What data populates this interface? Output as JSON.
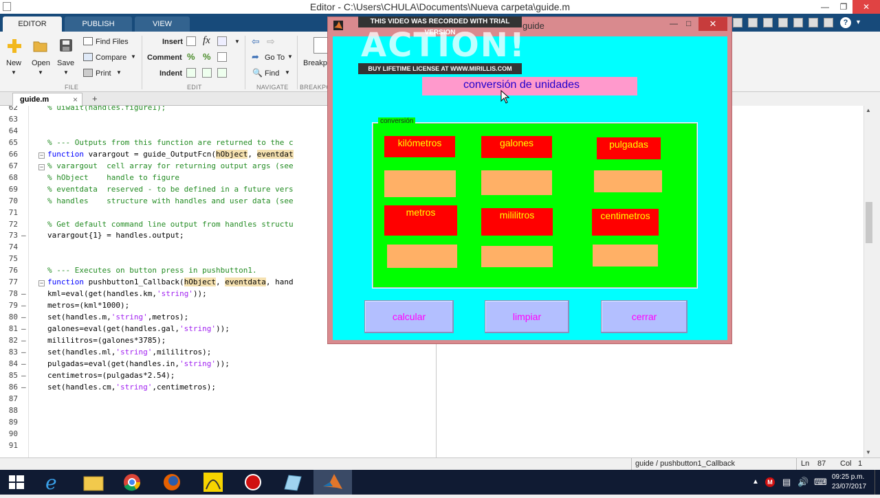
{
  "window": {
    "title": "Editor - C:\\Users\\CHULA\\Documents\\Nueva carpeta\\guide.m"
  },
  "ribbon": {
    "tabs": [
      "EDITOR",
      "PUBLISH",
      "VIEW"
    ],
    "file": {
      "new": "New",
      "open": "Open",
      "save": "Save",
      "find_files": "Find Files",
      "compare": "Compare",
      "print": "Print",
      "section": "FILE"
    },
    "edit": {
      "insert": "Insert",
      "comment": "Comment",
      "indent": "Indent",
      "section": "EDIT"
    },
    "navigate": {
      "goto": "Go To",
      "find": "Find",
      "section": "NAVIGATE"
    },
    "breakpoints": {
      "label": "Breakpo",
      "section": "BREAKPO"
    }
  },
  "editor": {
    "file_tab": "guide.m",
    "lines": [
      {
        "n": "62",
        "segments": [
          [
            "c",
            "% uiwait(handles.figure1);"
          ]
        ]
      },
      {
        "n": "63",
        "segments": []
      },
      {
        "n": "64",
        "segments": []
      },
      {
        "n": "65",
        "segments": [
          [
            "c",
            "% --- Outputs from this function are returned to the c"
          ]
        ]
      },
      {
        "n": "66",
        "fold": true,
        "segments": [
          [
            "k",
            "function"
          ],
          [
            "t",
            " varargout = guide_OutputFcn("
          ],
          [
            "h",
            "hObject"
          ],
          [
            "t",
            ", "
          ],
          [
            "h",
            "eventdat"
          ]
        ]
      },
      {
        "n": "67",
        "fold": true,
        "segments": [
          [
            "c",
            "% varargout  cell array for returning output args (see"
          ]
        ]
      },
      {
        "n": "68",
        "segments": [
          [
            "c",
            "% hObject    handle to figure"
          ]
        ]
      },
      {
        "n": "69",
        "segments": [
          [
            "c",
            "% eventdata  reserved - to be defined in a future vers"
          ]
        ]
      },
      {
        "n": "70",
        "segments": [
          [
            "c",
            "% handles    structure with handles and user data (see"
          ]
        ]
      },
      {
        "n": "71",
        "segments": []
      },
      {
        "n": "72",
        "segments": [
          [
            "c",
            "% Get default command line output from handles structu"
          ]
        ]
      },
      {
        "n": "73",
        "dash": true,
        "segments": [
          [
            "t",
            "varargout{1} = handles.output;"
          ]
        ]
      },
      {
        "n": "74",
        "segments": []
      },
      {
        "n": "75",
        "segments": []
      },
      {
        "n": "76",
        "segments": [
          [
            "c",
            "% --- Executes on button press in pushbutton1."
          ]
        ]
      },
      {
        "n": "77",
        "fold": true,
        "segments": [
          [
            "k",
            "function"
          ],
          [
            "t",
            " pushbutton1_Callback("
          ],
          [
            "h",
            "hObject"
          ],
          [
            "t",
            ", "
          ],
          [
            "h",
            "eventdata"
          ],
          [
            "t",
            ", hand"
          ]
        ]
      },
      {
        "n": "78",
        "dash": true,
        "segments": [
          [
            "t",
            "kml=eval(get(handles.km,"
          ],
          [
            "s",
            "'string'"
          ],
          [
            "t",
            "));"
          ]
        ]
      },
      {
        "n": "79",
        "dash": true,
        "segments": [
          [
            "t",
            "metros=(kml*1000);"
          ]
        ]
      },
      {
        "n": "80",
        "dash": true,
        "segments": [
          [
            "t",
            "set(handles.m,"
          ],
          [
            "s",
            "'string'"
          ],
          [
            "t",
            ",metros);"
          ]
        ]
      },
      {
        "n": "81",
        "dash": true,
        "segments": [
          [
            "t",
            "galones=eval(get(handles.gal,"
          ],
          [
            "s",
            "'string'"
          ],
          [
            "t",
            "));"
          ]
        ]
      },
      {
        "n": "82",
        "dash": true,
        "segments": [
          [
            "t",
            "mililitros=(galones*3785);"
          ]
        ]
      },
      {
        "n": "83",
        "dash": true,
        "segments": [
          [
            "t",
            "set(handles.ml,"
          ],
          [
            "s",
            "'string'"
          ],
          [
            "t",
            ",mililitros);"
          ]
        ]
      },
      {
        "n": "84",
        "dash": true,
        "segments": [
          [
            "t",
            "pulgadas=eval(get(handles.in,"
          ],
          [
            "s",
            "'string'"
          ],
          [
            "t",
            "));"
          ]
        ]
      },
      {
        "n": "85",
        "dash": true,
        "segments": [
          [
            "t",
            "centimetros=(pulgadas*2.54);"
          ]
        ]
      },
      {
        "n": "86",
        "dash": true,
        "segments": [
          [
            "t",
            "set(handles.cm,"
          ],
          [
            "s",
            "'string'"
          ],
          [
            "t",
            ",centimetros);"
          ]
        ]
      },
      {
        "n": "87",
        "segments": []
      },
      {
        "n": "88",
        "segments": []
      },
      {
        "n": "89",
        "segments": []
      },
      {
        "n": "90",
        "segments": []
      },
      {
        "n": "91",
        "segments": []
      }
    ]
  },
  "status": {
    "function": "guide / pushbutton1_Callback",
    "ln_label": "Ln",
    "ln": "87",
    "col_label": "Col",
    "col": "1"
  },
  "gui": {
    "title": "guide",
    "heading": "conversión de unidades",
    "panel_title": "conversión",
    "labels": {
      "km": "kilómetros",
      "gal": "galones",
      "in": "pulgadas",
      "m": "metros",
      "ml": "mililitros",
      "cm": "centimetros"
    },
    "buttons": {
      "calc": "calcular",
      "clear": "limpiar",
      "close": "cerrar"
    }
  },
  "watermark": {
    "top": "THIS VIDEO WAS RECORDED WITH TRIAL VERSION",
    "logo": "ACTION!",
    "bottom": "BUY LIFETIME LICENSE AT WWW.MIRILLIS.COM"
  },
  "taskbar": {
    "time": "09:25 p.m.",
    "date": "23/07/2017"
  },
  "colors": {
    "ribbon_tab": "#174a7a",
    "gui_bg": "#00ffff",
    "panel": "#00ff00",
    "label_bg": "#ff0000",
    "label_text": "#ffff00",
    "edit_bg": "#ffb066",
    "button_bg": "#b3bfff",
    "button_text": "#ff00ff",
    "heading_bg": "#ff99cc"
  }
}
